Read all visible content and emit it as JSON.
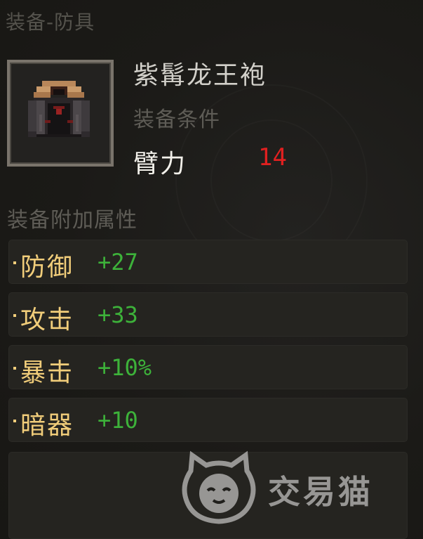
{
  "header": {
    "title": "装备-防具"
  },
  "item": {
    "name": "紫髯龙王袍",
    "icon": "robe-icon"
  },
  "requirement": {
    "title": "装备条件",
    "stat": "臂力",
    "value": "14",
    "value_color": "#e02020"
  },
  "attributes": {
    "title": "装备附加属性",
    "rows": [
      {
        "label": "防御",
        "value": "+27"
      },
      {
        "label": "攻击",
        "value": "+33"
      },
      {
        "label": "暴击",
        "value": "+10%"
      },
      {
        "label": "暗器",
        "value": "+10"
      }
    ],
    "label_color": "#f1cd7a",
    "value_color": "#3db23a"
  },
  "watermark": {
    "text": "交易猫",
    "icon": "cat-logo-icon"
  }
}
